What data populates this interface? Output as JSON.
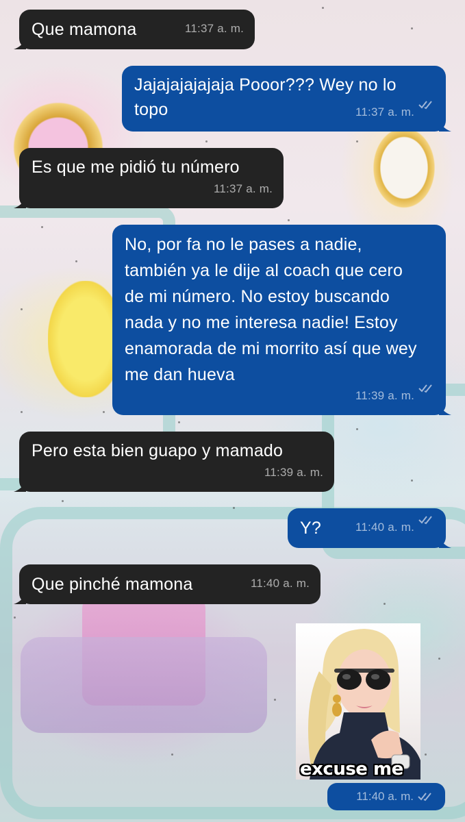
{
  "chat": {
    "messages": [
      {
        "dir": "in",
        "text": "Que mamona",
        "time": "11:37 a. m."
      },
      {
        "dir": "out",
        "text": "Jajajajajajaja Pooor??? Wey no lo topo",
        "time": "11:37 a. m.",
        "status": "read"
      },
      {
        "dir": "in",
        "text": "Es que me pidió tu número",
        "time": "11:37 a. m."
      },
      {
        "dir": "out",
        "text": "No, por fa no le pases a nadie, también ya le dije al coach que cero de mi número. No estoy buscando nada y no me interesa nadie! Estoy enamorada de mi morrito así que wey me dan hueva",
        "time": "11:39 a. m.",
        "status": "read"
      },
      {
        "dir": "in",
        "text": "Pero esta bien guapo y mamado",
        "time": "11:39 a. m."
      },
      {
        "dir": "out",
        "text": "Y?",
        "time": "11:40 a. m.",
        "status": "read"
      },
      {
        "dir": "in",
        "text": "Que pinché mamona",
        "time": "11:40 a. m."
      }
    ],
    "sticker": {
      "caption": "excuse me",
      "time": "11:40 a. m.",
      "status": "read"
    }
  },
  "colors": {
    "incoming_bubble": "#232323",
    "outgoing_bubble": "#0d4ea0",
    "read_ticks": "#ffffff"
  },
  "icons": {
    "status_read": "double-check-icon"
  }
}
